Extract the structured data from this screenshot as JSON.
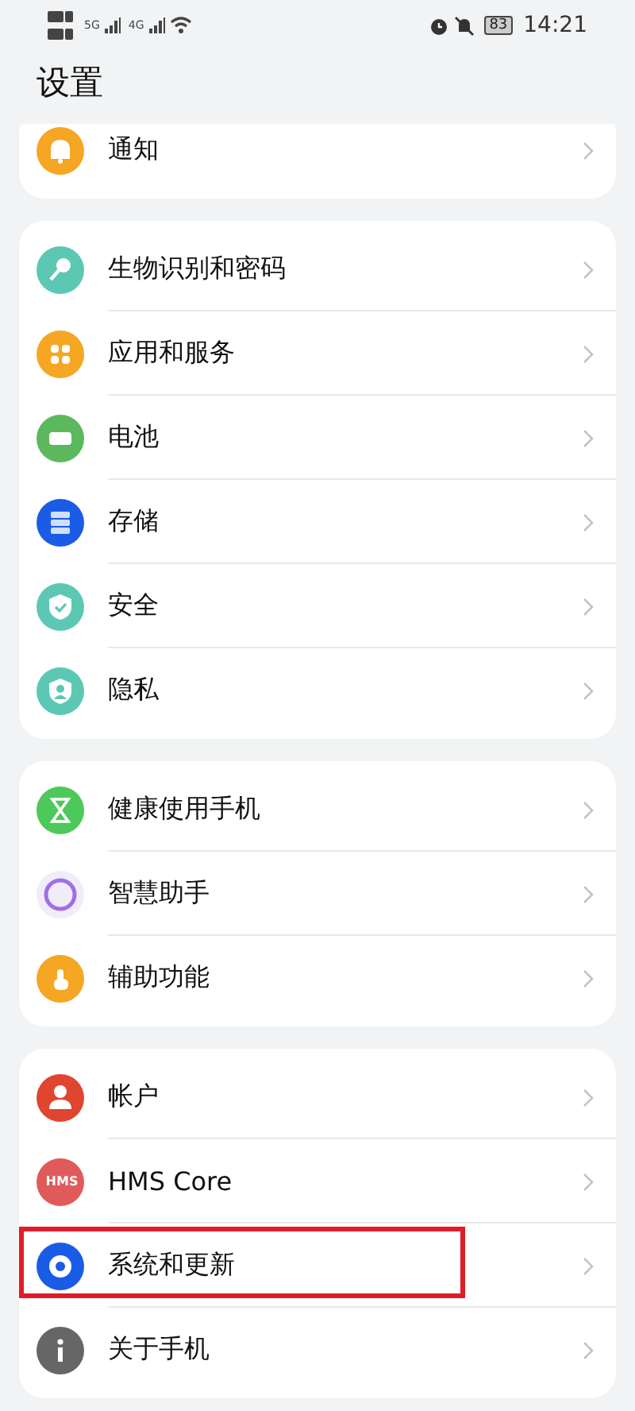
{
  "status_bar": {
    "network": [
      "5G",
      "4G"
    ],
    "battery": "83",
    "time": "14:21"
  },
  "title": "设置",
  "groups": [
    {
      "partial": true,
      "items": [
        {
          "label": "通知",
          "color": "#f5a623",
          "highlighted": false
        }
      ]
    },
    {
      "partial": false,
      "items": [
        {
          "label": "生物识别和密码",
          "color": "#5cc8b4",
          "highlighted": false
        },
        {
          "label": "应用和服务",
          "color": "#f5a623",
          "highlighted": false
        },
        {
          "label": "电池",
          "color": "#5cb85c",
          "highlighted": false
        },
        {
          "label": "存储",
          "color": "#1a5ce6",
          "highlighted": false
        },
        {
          "label": "安全",
          "color": "#5cc8b4",
          "highlighted": false
        },
        {
          "label": "隐私",
          "color": "#5cc8b4",
          "highlighted": false
        }
      ]
    },
    {
      "partial": false,
      "items": [
        {
          "label": "健康使用手机",
          "color": "#4cc95a",
          "highlighted": false
        },
        {
          "label": "智慧助手",
          "color": "#a06ee6",
          "highlighted": false
        },
        {
          "label": "辅助功能",
          "color": "#f5a623",
          "highlighted": false
        }
      ]
    },
    {
      "partial": false,
      "items": [
        {
          "label": "帐户",
          "color": "#e0452f",
          "highlighted": false
        },
        {
          "label": "HMS Core",
          "color": "#e05a5a",
          "icon_text": "HMS",
          "highlighted": false
        },
        {
          "label": "系统和更新",
          "color": "#1a5ce6",
          "highlighted": true
        },
        {
          "label": "关于手机",
          "color": "#666666",
          "highlighted": false
        }
      ]
    }
  ]
}
